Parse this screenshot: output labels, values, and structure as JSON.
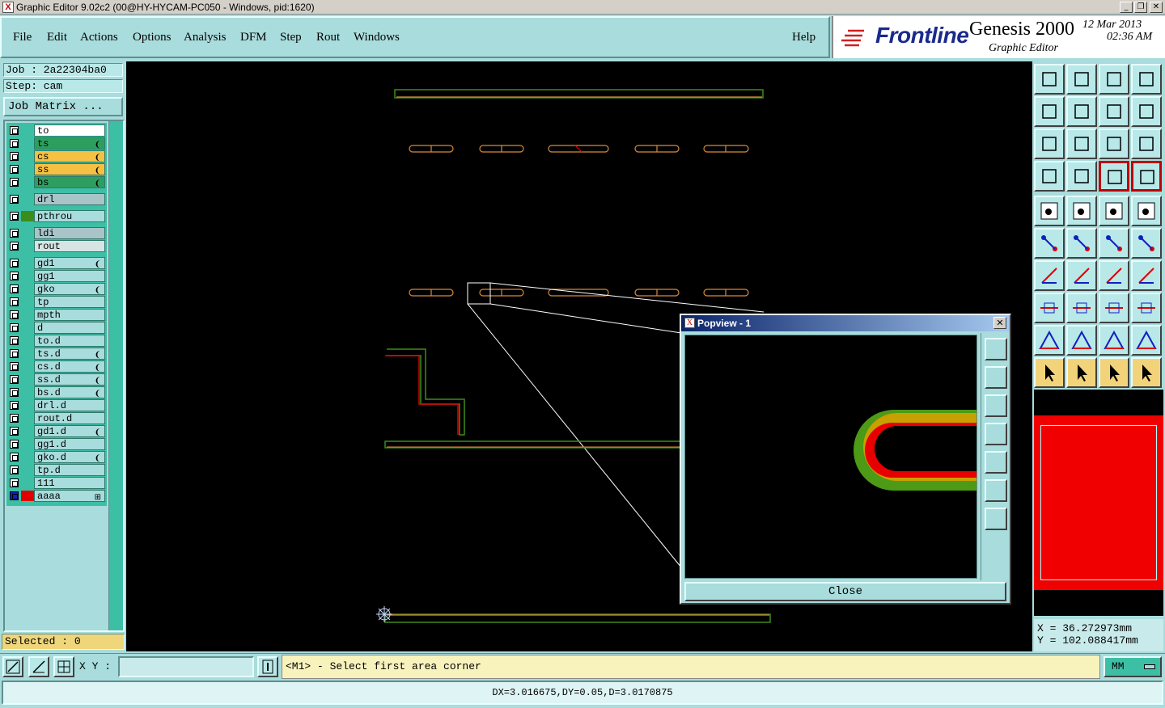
{
  "window": {
    "title": "Graphic Editor 9.02c2 (00@HY-HYCAM-PC050 - Windows, pid:1620)"
  },
  "menu": {
    "items": [
      "File",
      "Edit",
      "Actions",
      "Options",
      "Analysis",
      "DFM",
      "Step",
      "Rout",
      "Windows"
    ],
    "help": "Help"
  },
  "brand": {
    "logo": "Frontline",
    "product": "Genesis 2000",
    "subtitle": "Graphic Editor",
    "date": "12 Mar 2013",
    "time": "02:36 AM"
  },
  "job": {
    "job_label": "Job : 2a22304ba0",
    "step_label": "Step: cam",
    "matrix_button": "Job Matrix ..."
  },
  "layers": [
    {
      "name": "to",
      "bg": "#ffffff",
      "mark": ""
    },
    {
      "name": "ts",
      "bg": "#2e9e5e",
      "mark": "❨"
    },
    {
      "name": "cs",
      "bg": "#f5c043",
      "mark": "❨"
    },
    {
      "name": "ss",
      "bg": "#f5c043",
      "mark": "❨"
    },
    {
      "name": "bs",
      "bg": "#2e9e5e",
      "mark": "❨"
    },
    {
      "name": "drl",
      "bg": "#a8c4c8",
      "mark": ""
    },
    {
      "name": "pthrou",
      "bg": "#a9dcdc",
      "mark": "",
      "color": "#3c8c1c"
    },
    {
      "name": "ldi",
      "bg": "#a8c4c8",
      "mark": ""
    },
    {
      "name": "rout",
      "bg": "#d6e4e4",
      "mark": ""
    },
    {
      "name": "gd1",
      "bg": "#a9dcdc",
      "mark": "❨"
    },
    {
      "name": "gg1",
      "bg": "#a9dcdc",
      "mark": ""
    },
    {
      "name": "gko",
      "bg": "#a9dcdc",
      "mark": "❨"
    },
    {
      "name": "tp",
      "bg": "#a9dcdc",
      "mark": ""
    },
    {
      "name": "mpth",
      "bg": "#a9dcdc",
      "mark": ""
    },
    {
      "name": "d",
      "bg": "#a9dcdc",
      "mark": ""
    },
    {
      "name": "to.d",
      "bg": "#a9dcdc",
      "mark": ""
    },
    {
      "name": "ts.d",
      "bg": "#a9dcdc",
      "mark": "❨"
    },
    {
      "name": "cs.d",
      "bg": "#a9dcdc",
      "mark": "❨"
    },
    {
      "name": "ss.d",
      "bg": "#a9dcdc",
      "mark": "❨"
    },
    {
      "name": "bs.d",
      "bg": "#a9dcdc",
      "mark": "❨"
    },
    {
      "name": "drl.d",
      "bg": "#a9dcdc",
      "mark": ""
    },
    {
      "name": "rout.d",
      "bg": "#a9dcdc",
      "mark": ""
    },
    {
      "name": "gd1.d",
      "bg": "#a9dcdc",
      "mark": "❨"
    },
    {
      "name": "gg1.d",
      "bg": "#a9dcdc",
      "mark": ""
    },
    {
      "name": "gko.d",
      "bg": "#a9dcdc",
      "mark": "❨"
    },
    {
      "name": "tp.d",
      "bg": "#a9dcdc",
      "mark": ""
    },
    {
      "name": "111",
      "bg": "#a9dcdc",
      "mark": ""
    },
    {
      "name": "aaaa",
      "bg": "#a9dcdc",
      "mark": "⊞",
      "color": "#e00000",
      "chk": "#1020c0"
    }
  ],
  "selected": "Selected : 0",
  "popview": {
    "title": "Popview - 1",
    "close_label": "Close"
  },
  "coords": {
    "x": "X = 36.272973mm",
    "y": "Y = 102.088417mm"
  },
  "command": {
    "xy_label": "X Y :",
    "xy_value": "",
    "message": "<M1> - Select first area corner",
    "units": "MM"
  },
  "status": "DX=3.016675,DY=0.05,D=3.0170875",
  "colors": {
    "panel": "#a9dcdc",
    "green_trace": "#3c8c1c",
    "orange_trace": "#d88a3a",
    "red_trace": "#e00000",
    "yellow_trace": "#c8a000"
  }
}
